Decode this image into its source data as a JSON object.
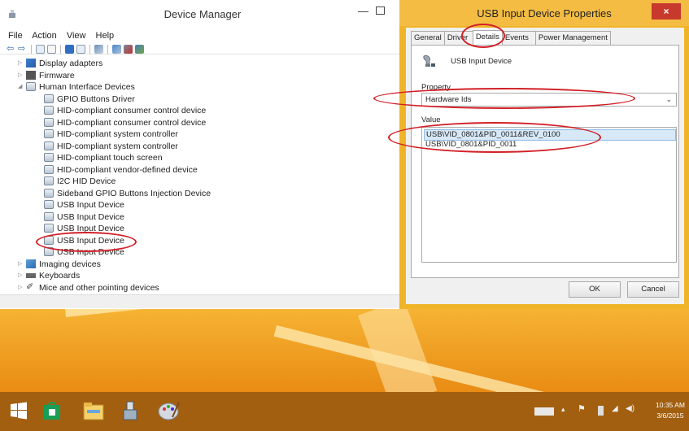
{
  "device_manager": {
    "title": "Device Manager",
    "menu": [
      "File",
      "Action",
      "View",
      "Help"
    ],
    "tree": [
      {
        "level": 1,
        "expander": "closed",
        "icon": "display-adapter-icon",
        "label": "Display adapters"
      },
      {
        "level": 1,
        "expander": "closed",
        "icon": "firmware-icon",
        "label": "Firmware"
      },
      {
        "level": 1,
        "expander": "open",
        "icon": "hid-category-icon",
        "label": "Human Interface Devices"
      },
      {
        "level": 2,
        "icon": "hid-device-icon",
        "label": "GPIO Buttons Driver"
      },
      {
        "level": 2,
        "icon": "hid-device-icon",
        "label": "HID-compliant consumer control device"
      },
      {
        "level": 2,
        "icon": "hid-device-icon",
        "label": "HID-compliant consumer control device"
      },
      {
        "level": 2,
        "icon": "hid-device-icon",
        "label": "HID-compliant system controller"
      },
      {
        "level": 2,
        "icon": "hid-device-icon",
        "label": "HID-compliant system controller"
      },
      {
        "level": 2,
        "icon": "hid-device-icon",
        "label": "HID-compliant touch screen"
      },
      {
        "level": 2,
        "icon": "hid-device-icon",
        "label": "HID-compliant vendor-defined device"
      },
      {
        "level": 2,
        "icon": "hid-device-icon",
        "label": "I2C HID Device"
      },
      {
        "level": 2,
        "icon": "hid-device-icon",
        "label": "Sideband GPIO Buttons Injection Device"
      },
      {
        "level": 2,
        "icon": "hid-device-icon",
        "label": "USB Input Device"
      },
      {
        "level": 2,
        "icon": "hid-device-icon",
        "label": "USB Input Device"
      },
      {
        "level": 2,
        "icon": "hid-device-icon",
        "label": "USB Input Device"
      },
      {
        "level": 2,
        "icon": "hid-device-icon",
        "label": "USB Input Device",
        "highlighted": true
      },
      {
        "level": 2,
        "icon": "hid-device-icon",
        "label": "USB Input Device"
      },
      {
        "level": 1,
        "expander": "closed",
        "icon": "imaging-devices-icon",
        "label": "Imaging devices"
      },
      {
        "level": 1,
        "expander": "closed",
        "icon": "keyboard-icon",
        "label": "Keyboards"
      },
      {
        "level": 1,
        "expander": "closed",
        "icon": "mouse-icon",
        "label": "Mice and other pointing devices"
      }
    ]
  },
  "properties_dialog": {
    "title": "USB Input Device Properties",
    "close_label": "×",
    "tabs": [
      {
        "label": "General",
        "active": false
      },
      {
        "label": "Driver",
        "active": false
      },
      {
        "label": "Details",
        "active": true
      },
      {
        "label": "Events",
        "active": false
      },
      {
        "label": "Power Management",
        "active": false
      }
    ],
    "device_name": "USB Input Device",
    "property_label": "Property",
    "property_value": "Hardware Ids",
    "value_label": "Value",
    "values": [
      {
        "text": "USB\\VID_0801&PID_0011&REV_0100",
        "selected": true
      },
      {
        "text": "USB\\VID_0801&PID_0011",
        "selected": false
      }
    ],
    "ok_label": "OK",
    "cancel_label": "Cancel"
  },
  "taskbar": {
    "apps": [
      "start-button",
      "store-icon",
      "file-explorer-icon",
      "device-manager-taskbar-icon",
      "paint-icon"
    ],
    "clock_time": "10:35 AM",
    "clock_date": "3/6/2015"
  },
  "colors": {
    "annotation_red": "#d21f26",
    "dialog_frame": "#f0b429",
    "taskbar": "#a25f10",
    "selection": "#d7e8f7"
  }
}
